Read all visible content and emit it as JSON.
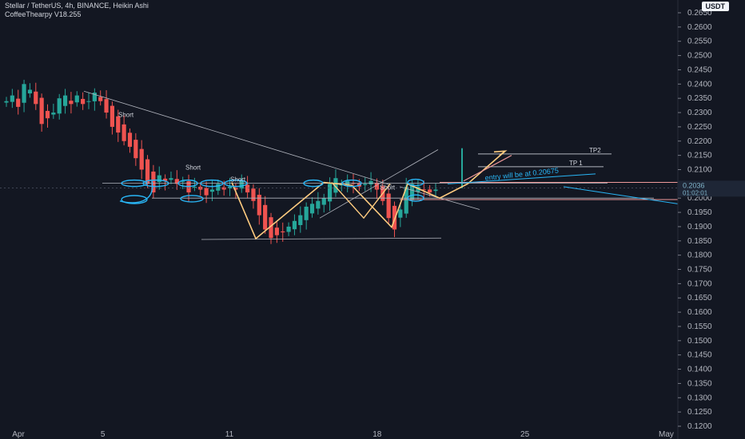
{
  "header": {
    "symbol_line": "Stellar / TetherUS, 4h, BINANCE, Heikin Ashi",
    "indicator_line": "CoffeeThearpy V18.255"
  },
  "currency_badge": "USDT",
  "colors": {
    "background": "#131722",
    "bull": "#26a69a",
    "bear": "#ef5350",
    "trend_line": "#b2b5be",
    "annotation_cyan": "#29b6f6",
    "zigzag": "#ffcc80",
    "target_line": "#ef9a9a"
  },
  "chart_data": {
    "type": "candlestick",
    "x_ticks": [
      {
        "label": "Apr",
        "day": 1
      },
      {
        "label": "5",
        "day": 5
      },
      {
        "label": "11",
        "day": 11
      },
      {
        "label": "18",
        "day": 18
      },
      {
        "label": "25",
        "day": 25
      },
      {
        "label": "May",
        "day": 31.7
      }
    ],
    "y_ticks": [
      "0.2650",
      "0.2600",
      "0.2550",
      "0.2500",
      "0.2450",
      "0.2400",
      "0.2350",
      "0.2300",
      "0.2250",
      "0.2200",
      "0.2150",
      "0.2100",
      "0.2050",
      "0.2000",
      "0.1950",
      "0.1900",
      "0.1850",
      "0.1800",
      "0.1750",
      "0.1700",
      "0.1650",
      "0.1600",
      "0.1550",
      "0.1500",
      "0.1450",
      "0.1400",
      "0.1350",
      "0.1300",
      "0.1250",
      "0.1200"
    ],
    "ylim": [
      0.12,
      0.265
    ],
    "xlim": [
      0.6,
      32.2
    ],
    "price_label_top": "0.2036",
    "price_label_bottom": "01:02:01",
    "current_price": 0.2036,
    "approx_close": [
      0.234,
      0.236,
      0.232,
      0.24,
      0.238,
      0.233,
      0.226,
      0.228,
      0.23,
      0.235,
      0.236,
      0.233,
      0.236,
      0.233,
      0.234,
      0.237,
      0.234,
      0.23,
      0.225,
      0.223,
      0.22,
      0.218,
      0.214,
      0.21,
      0.205,
      0.202,
      0.208,
      0.206,
      0.207,
      0.205,
      0.206,
      0.202,
      0.204,
      0.203,
      0.201,
      0.203,
      0.205,
      0.203,
      0.204,
      0.203,
      0.206,
      0.202,
      0.199,
      0.194,
      0.189,
      0.186,
      0.187,
      0.188,
      0.19,
      0.192,
      0.194,
      0.197,
      0.198,
      0.199,
      0.2,
      0.205,
      0.207,
      0.205,
      0.206,
      0.205,
      0.204,
      0.205,
      0.206,
      0.203,
      0.199,
      0.193,
      0.189,
      0.196,
      0.204,
      0.205,
      0.204,
      0.203,
      0.202,
      0.203
    ],
    "annotations": [
      "Short",
      "Short",
      "Short",
      "Short",
      "TP2",
      "TP 1",
      "entry will be at 0.20675"
    ]
  }
}
